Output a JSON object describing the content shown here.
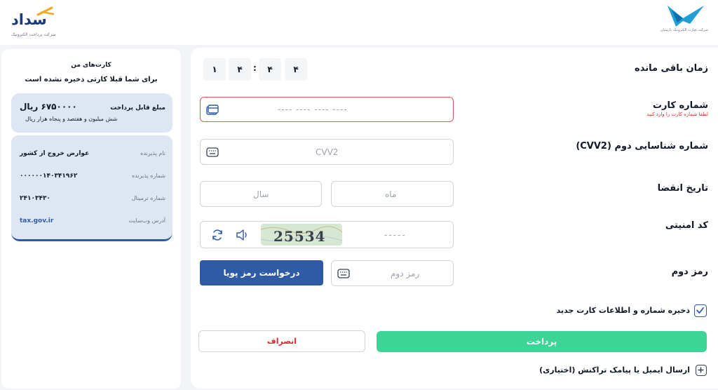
{
  "header": {
    "brand_name": "سداد",
    "brand_subtitle": "شرکت پرداخت الکترونیک",
    "bank_subtitle": "شرکت تجارت الکترونیک پارسیان"
  },
  "timer": {
    "label": "زمان باقی مانده",
    "digits": [
      "۱",
      "۴",
      "۴",
      "۴"
    ],
    "separator": ":"
  },
  "card_number": {
    "label": "شماره کارت",
    "error": "لطفا شماره کارت را وارد کنید",
    "placeholder": "---- ---- ---- ----",
    "icon": "card-icon"
  },
  "cvv2": {
    "label": "شماره شناسایی دوم (CVV2)",
    "placeholder": "CVV2",
    "icon": "keyboard-icon"
  },
  "expiry": {
    "label": "تاریخ انقضا",
    "month_placeholder": "ماه",
    "year_placeholder": "سال"
  },
  "captcha": {
    "label": "کد امنیتی",
    "placeholder": "-----",
    "code": "25534",
    "icons": [
      "refresh-icon",
      "speaker-icon"
    ]
  },
  "otp": {
    "label": "رمز دوم",
    "placeholder": "رمز دوم",
    "button_label": "درخواست رمز پویا",
    "icon": "keyboard-icon"
  },
  "save_card": {
    "label": "ذخیره شماره و اطلاعات کارت جدید",
    "checked": true
  },
  "actions": {
    "pay_label": "پرداخت",
    "cancel_label": "انصراف"
  },
  "notify": {
    "label": "ارسال ایمیل یا پیامک تراکنش (اختیاری)"
  },
  "side": {
    "title": "کارت‌های من",
    "subtitle": "برای شما قبلا کارتی ذخیره نشده است",
    "amount_label": "مبلغ قابل پرداخت",
    "amount_value": "۶۷۵۰۰۰۰ ریال",
    "amount_words": "شش میلیون و هفتصد و پنجاه هزار ریال",
    "merchant_label": "نام پذیرنده",
    "merchant_value": "عوارض خروج از کشور",
    "merchant_id_label": "شماره پذیرنده",
    "merchant_id_value": "۰۰۰۰۰۰۱۴۰۳۴۱۹۶۲",
    "terminal_label": "شماره ترمینال",
    "terminal_value": "۲۴۱۰۳۴۳۰",
    "website_label": "آدرس وب‌سایت",
    "website_value": "tax.gov.ir"
  },
  "colors": {
    "primary": "#2f5ba6",
    "pay": "#3dd597",
    "error": "#e05a5a",
    "panel_card": "#dfe6f3"
  }
}
